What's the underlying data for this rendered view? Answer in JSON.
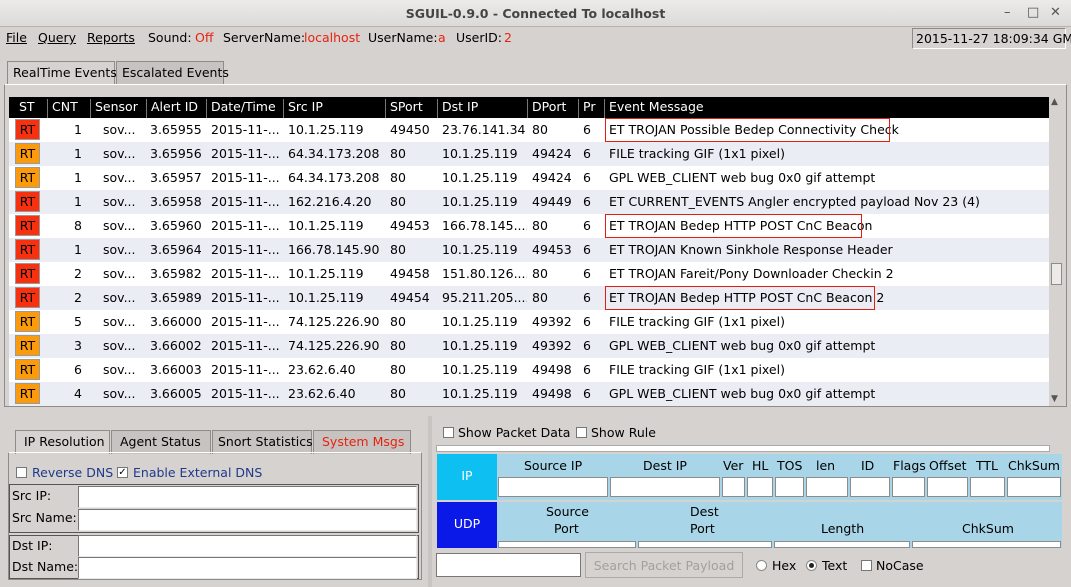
{
  "window": {
    "title": "SGUIL-0.9.0 - Connected To localhost",
    "minimize": "–",
    "maximize": "□",
    "close": "✕"
  },
  "menubar": {
    "file": "File",
    "query": "Query",
    "reports": "Reports",
    "sound_label": "Sound:",
    "sound_value": "Off",
    "server_label": "ServerName:",
    "server_value": "localhost",
    "user_label": "UserName:",
    "user_value": "a",
    "userid_label": "UserID:",
    "userid_value": "2",
    "clock": "2015-11-27 18:09:34 GMT"
  },
  "top_tabs": [
    "RealTime Events",
    "Escalated Events"
  ],
  "columns": [
    "ST",
    "CNT",
    "Sensor",
    "Alert ID",
    "Date/Time",
    "Src IP",
    "SPort",
    "Dst IP",
    "DPort",
    "Pr",
    "Event Message"
  ],
  "status_colors": {
    "red": "#f7300f",
    "orange": "#fb9a0a",
    "highlight_border": "#e21e14"
  },
  "events": [
    {
      "st": "RT",
      "color": "red",
      "cnt": "1",
      "sensor": "sov...",
      "alert_id": "3.65955",
      "datetime": "2015-11-...",
      "src_ip": "10.1.25.119",
      "sport": "49450",
      "dst_ip": "23.76.141.34",
      "dport": "80",
      "pr": "6",
      "message": "ET TROJAN Possible Bedep Connectivity Check",
      "highlighted": true
    },
    {
      "st": "RT",
      "color": "orange",
      "cnt": "1",
      "sensor": "sov...",
      "alert_id": "3.65956",
      "datetime": "2015-11-...",
      "src_ip": "64.34.173.208",
      "sport": "80",
      "dst_ip": "10.1.25.119",
      "dport": "49424",
      "pr": "6",
      "message": "FILE tracking GIF (1x1 pixel)",
      "highlighted": false
    },
    {
      "st": "RT",
      "color": "orange",
      "cnt": "1",
      "sensor": "sov...",
      "alert_id": "3.65957",
      "datetime": "2015-11-...",
      "src_ip": "64.34.173.208",
      "sport": "80",
      "dst_ip": "10.1.25.119",
      "dport": "49424",
      "pr": "6",
      "message": "GPL WEB_CLIENT web bug 0x0 gif attempt",
      "highlighted": false
    },
    {
      "st": "RT",
      "color": "red",
      "cnt": "1",
      "sensor": "sov...",
      "alert_id": "3.65958",
      "datetime": "2015-11-...",
      "src_ip": "162.216.4.20",
      "sport": "80",
      "dst_ip": "10.1.25.119",
      "dport": "49449",
      "pr": "6",
      "message": "ET CURRENT_EVENTS Angler encrypted payload Nov 23 (4)",
      "highlighted": false
    },
    {
      "st": "RT",
      "color": "red",
      "cnt": "8",
      "sensor": "sov...",
      "alert_id": "3.65960",
      "datetime": "2015-11-...",
      "src_ip": "10.1.25.119",
      "sport": "49453",
      "dst_ip": "166.78.145....",
      "dport": "80",
      "pr": "6",
      "message": "ET TROJAN Bedep HTTP POST CnC Beacon",
      "highlighted": true
    },
    {
      "st": "RT",
      "color": "red",
      "cnt": "1",
      "sensor": "sov...",
      "alert_id": "3.65964",
      "datetime": "2015-11-...",
      "src_ip": "166.78.145.90",
      "sport": "80",
      "dst_ip": "10.1.25.119",
      "dport": "49453",
      "pr": "6",
      "message": "ET TROJAN Known Sinkhole Response Header",
      "highlighted": false
    },
    {
      "st": "RT",
      "color": "red",
      "cnt": "2",
      "sensor": "sov...",
      "alert_id": "3.65982",
      "datetime": "2015-11-...",
      "src_ip": "10.1.25.119",
      "sport": "49458",
      "dst_ip": "151.80.126....",
      "dport": "80",
      "pr": "6",
      "message": "ET TROJAN Fareit/Pony Downloader Checkin 2",
      "highlighted": false
    },
    {
      "st": "RT",
      "color": "red",
      "cnt": "2",
      "sensor": "sov...",
      "alert_id": "3.65989",
      "datetime": "2015-11-...",
      "src_ip": "10.1.25.119",
      "sport": "49454",
      "dst_ip": "95.211.205....",
      "dport": "80",
      "pr": "6",
      "message": "ET TROJAN Bedep HTTP POST CnC Beacon 2",
      "highlighted": true
    },
    {
      "st": "RT",
      "color": "orange",
      "cnt": "5",
      "sensor": "sov...",
      "alert_id": "3.66000",
      "datetime": "2015-11-...",
      "src_ip": "74.125.226.90",
      "sport": "80",
      "dst_ip": "10.1.25.119",
      "dport": "49392",
      "pr": "6",
      "message": "FILE tracking GIF (1x1 pixel)",
      "highlighted": false
    },
    {
      "st": "RT",
      "color": "orange",
      "cnt": "3",
      "sensor": "sov...",
      "alert_id": "3.66002",
      "datetime": "2015-11-...",
      "src_ip": "74.125.226.90",
      "sport": "80",
      "dst_ip": "10.1.25.119",
      "dport": "49392",
      "pr": "6",
      "message": "GPL WEB_CLIENT web bug 0x0 gif attempt",
      "highlighted": false
    },
    {
      "st": "RT",
      "color": "orange",
      "cnt": "6",
      "sensor": "sov...",
      "alert_id": "3.66003",
      "datetime": "2015-11-...",
      "src_ip": "23.62.6.40",
      "sport": "80",
      "dst_ip": "10.1.25.119",
      "dport": "49498",
      "pr": "6",
      "message": "FILE tracking GIF (1x1 pixel)",
      "highlighted": false
    },
    {
      "st": "RT",
      "color": "orange",
      "cnt": "4",
      "sensor": "sov...",
      "alert_id": "3.66005",
      "datetime": "2015-11-...",
      "src_ip": "23.62.6.40",
      "sport": "80",
      "dst_ip": "10.1.25.119",
      "dport": "49498",
      "pr": "6",
      "message": "GPL WEB_CLIENT web bug 0x0 gif attempt",
      "highlighted": false
    }
  ],
  "lower_tabs": [
    "IP Resolution",
    "Agent Status",
    "Snort Statistics",
    "System Msgs"
  ],
  "dns": {
    "reverse": "Reverse DNS",
    "external": "Enable External DNS",
    "reverse_checked": false,
    "external_checked": true
  },
  "ip_fields": {
    "src_ip": "Src IP:",
    "src_name": "Src Name:",
    "dst_ip": "Dst IP:",
    "dst_name": "Dst Name:"
  },
  "packet": {
    "show_data": "Show Packet Data",
    "show_rule": "Show Rule"
  },
  "ip_header": {
    "proto": "IP",
    "cols": [
      "Source IP",
      "Dest IP",
      "Ver",
      "HL",
      "TOS",
      "len",
      "ID",
      "Flags",
      "Offset",
      "TTL",
      "ChkSum"
    ]
  },
  "udp_header": {
    "proto": "UDP",
    "source_port": [
      "Source",
      "Port"
    ],
    "dest_port": [
      "Dest",
      "Port"
    ],
    "length": "Length",
    "chksum": "ChkSum"
  },
  "search": {
    "button": "Search Packet Payload",
    "hex": "Hex",
    "text": "Text",
    "nocase": "NoCase",
    "selected": "Text"
  }
}
